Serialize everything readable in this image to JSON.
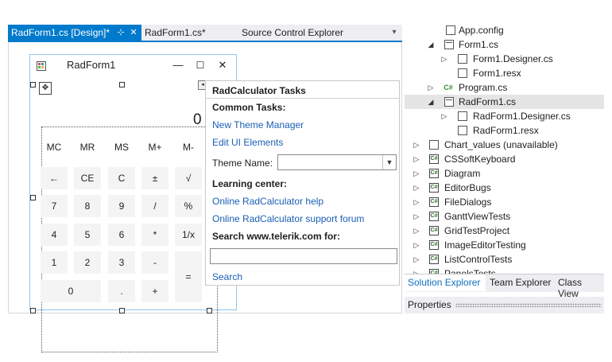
{
  "tabs": {
    "active_label": "RadForm1.cs [Design]*",
    "pin_glyph": "⊹",
    "close_glyph": "✕",
    "tab2_label": "RadForm1.cs*",
    "tab3_label": "Source Control Explorer",
    "dropdown_glyph": "▾"
  },
  "form": {
    "title": "RadForm1",
    "minimize": "—",
    "maximize": "☐",
    "close": "✕"
  },
  "calculator": {
    "display": "0",
    "memory_keys": [
      "MC",
      "MR",
      "MS",
      "M+",
      "M-"
    ],
    "rows": [
      [
        "←",
        "CE",
        "C",
        "±",
        "√"
      ],
      [
        "7",
        "8",
        "9",
        "/",
        "%"
      ],
      [
        "4",
        "5",
        "6",
        "*",
        "1/x"
      ],
      [
        "1",
        "2",
        "3",
        "-",
        ""
      ],
      [
        "0",
        ".",
        "+",
        "="
      ]
    ]
  },
  "tasks_panel": {
    "title": "RadCalculator Tasks",
    "common_tasks": "Common Tasks:",
    "new_theme_manager": "New Theme Manager",
    "edit_ui_elements": "Edit UI Elements",
    "theme_name_label": "Theme Name:",
    "theme_name_value": "",
    "learning_center": "Learning center:",
    "help_link": "Online RadCalculator help",
    "forum_link": "Online RadCalculator support forum",
    "search_label": "Search www.telerik.com for:",
    "search_value": "",
    "search_link": "Search"
  },
  "solution_explorer": {
    "items": [
      {
        "label": "App.config",
        "icon": "config-icon",
        "expander": ""
      },
      {
        "label": "Form1.cs",
        "icon": "form-icon",
        "expander": "◢"
      },
      {
        "label": "Form1.Designer.cs",
        "icon": "cs-file-icon",
        "expander": "▷"
      },
      {
        "label": "Form1.resx",
        "icon": "resx-file-icon",
        "expander": ""
      },
      {
        "label": "Program.cs",
        "icon": "csharp-icon",
        "expander": "▷"
      },
      {
        "label": "RadForm1.cs",
        "icon": "form-icon",
        "expander": "◢",
        "selected": true
      },
      {
        "label": "RadForm1.Designer.cs",
        "icon": "cs-file-icon",
        "expander": "▷"
      },
      {
        "label": "RadForm1.resx",
        "icon": "resx-file-icon",
        "expander": ""
      },
      {
        "label": "Chart_values (unavailable)",
        "icon": "unavailable-project-icon",
        "expander": "▷"
      },
      {
        "label": "CSSoftKeyboard",
        "icon": "csproj-icon",
        "expander": "▷"
      },
      {
        "label": "Diagram",
        "icon": "csproj-icon",
        "expander": "▷"
      },
      {
        "label": "EditorBugs",
        "icon": "csproj-icon",
        "expander": "▷"
      },
      {
        "label": "FileDialogs",
        "icon": "csproj-icon",
        "expander": "▷"
      },
      {
        "label": "GanttViewTests",
        "icon": "csproj-icon",
        "expander": "▷"
      },
      {
        "label": "GridTestProject",
        "icon": "csproj-icon",
        "expander": "▷"
      },
      {
        "label": "ImageEditorTesting",
        "icon": "csproj-icon",
        "expander": "▷"
      },
      {
        "label": "ListControlTests",
        "icon": "csproj-icon",
        "expander": "▷"
      },
      {
        "label": "PanelsTests",
        "icon": "csproj-icon",
        "expander": "▷"
      }
    ],
    "bottom_tabs": [
      "Solution Explorer",
      "Team Explorer",
      "Class View"
    ],
    "properties_label": "Properties"
  },
  "colors": {
    "accent": "#007acc",
    "link": "#1b5fb5",
    "selected_row": "#e5e5e5"
  }
}
